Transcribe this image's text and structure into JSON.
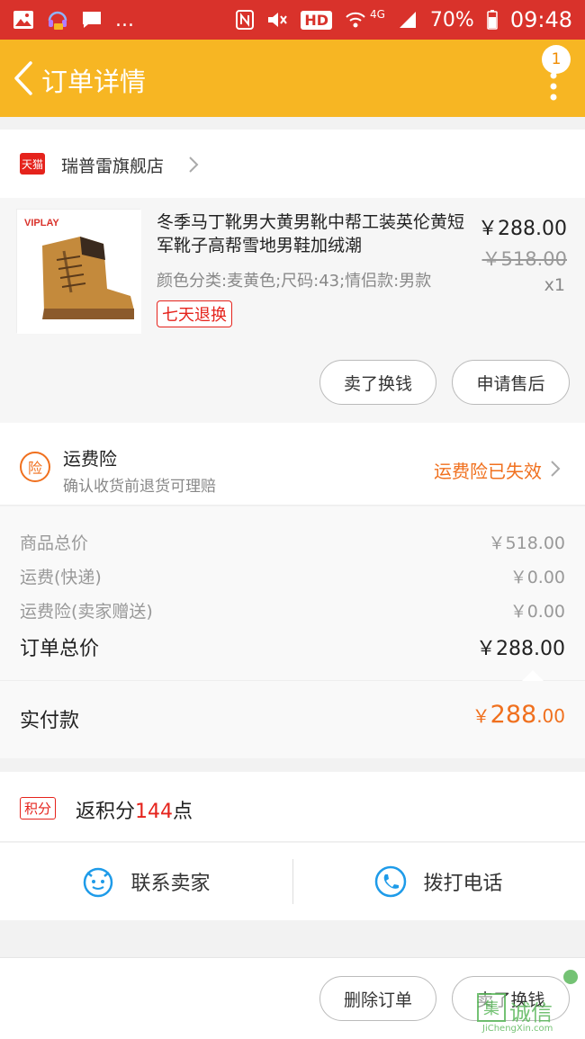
{
  "status_bar": {
    "more": "...",
    "hd": "HD",
    "network": "4G",
    "battery": "70%",
    "time": "09:48",
    "icons": [
      "gallery-icon",
      "headset-icon",
      "message-icon",
      "nfc-icon",
      "mute-icon",
      "wifi-icon",
      "signal-icon",
      "battery-icon"
    ]
  },
  "nav": {
    "title": "订单详情",
    "badge_count": "1"
  },
  "store": {
    "logo_text": "天猫",
    "name": "瑞普雷旗舰店"
  },
  "product": {
    "brand": "VIPLAY",
    "title": "冬季马丁靴男大黄男靴中帮工装英伦黄短军靴子高帮雪地男鞋加绒潮",
    "sku": "颜色分类:麦黄色;尺码:43;情侣款:男款",
    "return_tag": "七天退换",
    "price": "￥288.00",
    "original_price": "￥518.00",
    "quantity": "x1",
    "actions": {
      "sell": "卖了换钱",
      "after_sale": "申请售后"
    }
  },
  "insurance": {
    "icon_text": "险",
    "title": "运费险",
    "subtitle": "确认收货前退货可理赔",
    "status": "运费险已失效"
  },
  "summary": {
    "rows": [
      {
        "label": "商品总价",
        "value": "￥518.00"
      },
      {
        "label": "运费(快递)",
        "value": "￥0.00"
      },
      {
        "label": "运费险(卖家赠送)",
        "value": "￥0.00"
      }
    ],
    "total_label": "订单总价",
    "total_value": "￥288.00"
  },
  "paid": {
    "label": "实付款",
    "currency": "￥",
    "integer": "288",
    "decimal": ".00"
  },
  "points": {
    "tag": "积分",
    "prefix": "返积分",
    "number": "144",
    "suffix": "点"
  },
  "contact": {
    "seller": "联系卖家",
    "phone": "拨打电话"
  },
  "bottom": {
    "delete": "删除订单",
    "sell": "卖了换钱"
  },
  "watermark": {
    "char": "集",
    "text": "诚信",
    "sub": "JiChengXin.com"
  },
  "colors": {
    "status_bar": "#d9322b",
    "nav": "#f7b623",
    "accent_orange": "#f0701e",
    "tmall_red": "#e5231c"
  }
}
